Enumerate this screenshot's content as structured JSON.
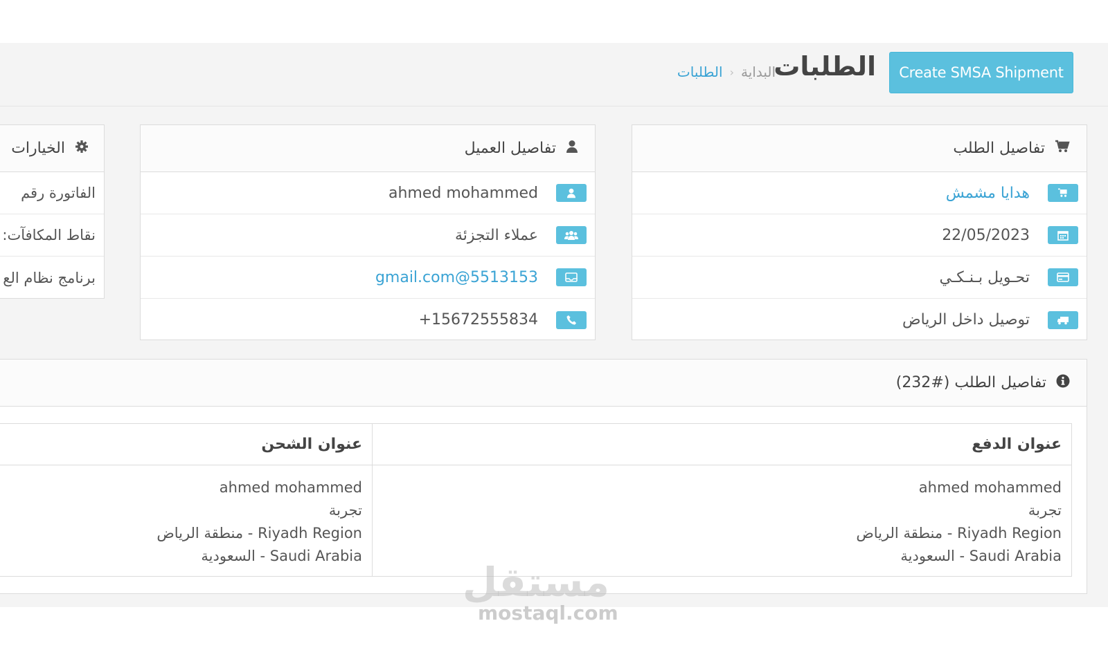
{
  "header": {
    "create_button": "Create SMSA Shipment",
    "title": "الطلبات",
    "breadcrumb": {
      "home": "البداية",
      "separator": "‹",
      "current": "الطلبات"
    }
  },
  "order_panel": {
    "title": "تفاصيل الطلب",
    "store": "هدايا مشمش",
    "date": "22/05/2023",
    "payment_method": "تحـويل بـنـكـي",
    "shipping_method": "توصيل داخل الرياض"
  },
  "customer_panel": {
    "title": "تفاصيل العميل",
    "name": "ahmed mohammed",
    "group": "عملاء التجزئة",
    "email": "gmail.com@5513153",
    "phone": "15672555834+"
  },
  "options_panel": {
    "title": "الخيارات",
    "invoice": "الفاتورة رقم",
    "reward_points": "نقاط المكافآت:",
    "affiliate": "برنامج نظام الع"
  },
  "details_panel": {
    "title": "تفاصيل الطلب (#232)",
    "payment_address": {
      "heading": "عنوان الدفع",
      "name": "ahmed mohammed",
      "line1": "تجربة",
      "region": "Riyadh Region - منطقة الرياض",
      "country": "Saudi Arabia - السعودية"
    },
    "shipping_address": {
      "heading": "عنوان الشحن",
      "name": "ahmed mohammed",
      "line1": "تجربة",
      "region": "Riyadh Region - منطقة الرياض",
      "country": "Saudi Arabia - السعودية"
    }
  },
  "watermark": {
    "logo": "مستقل",
    "site": "mostaql.com"
  },
  "colors": {
    "accent": "#5bc0de",
    "link": "#3aa3d4",
    "background": "#f4f4f4"
  },
  "icons": {
    "cart": "cart-icon",
    "user": "user-icon",
    "gear": "gear-icon",
    "calendar": "calendar-icon",
    "credit_card": "credit-card-icon",
    "truck": "truck-icon",
    "group": "group-icon",
    "envelope": "envelope-icon",
    "phone": "phone-icon",
    "info": "info-icon"
  }
}
